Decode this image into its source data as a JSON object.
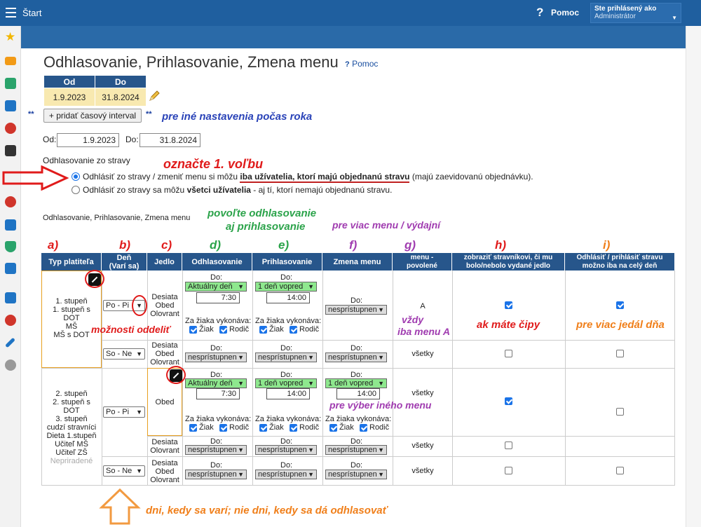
{
  "topbar": {
    "start": "Štart",
    "help": "Pomoc",
    "help_icon": "?",
    "user_label": "Ste prihlásený ako",
    "user_role": "Administrátor"
  },
  "sidebar": {
    "icons": [
      "star-icon",
      "mail-icon",
      "home-icon",
      "book-icon",
      "user-icon",
      "calendar-icon",
      "badge-icon",
      "briefcase-icon",
      "shield-icon",
      "chart-icon",
      "library-icon",
      "chat-icon",
      "pen-icon",
      "gear-icon"
    ]
  },
  "page": {
    "title": "Odhlasovanie, Prihlasovanie, Zmena menu",
    "help_link": "Pomoc",
    "help_prefix": "?"
  },
  "interval": {
    "col_od": "Od",
    "col_do": "Do",
    "od": "1.9.2023",
    "do": "31.8.2024",
    "add_button": "+ pridať časový interval",
    "stars": "**"
  },
  "filter": {
    "od_label": "Od:",
    "od_value": "1.9.2023",
    "do_label": "Do:",
    "do_value": "31.8.2024"
  },
  "unsubscribe": {
    "heading": "Odhlasovanie zo stravy",
    "option1_a": "Odhlásiť zo stravy / zmeniť menu si môžu",
    "option1_b": "iba užívatelia, ktorí majú objednanú stravu",
    "option1_c": "(majú zaevidovanú objednávku).",
    "option2_a": "Odhlásiť zo stravy sa môžu",
    "option2_b": "všetci užívatelia",
    "option2_c": "- aj tí, ktorí nemajú objednanú stravu."
  },
  "section_label": "Odhlasovanie, Prihlasovanie, Zmena menu",
  "annotations": {
    "other_settings": "pre iné nastavenia počas roka",
    "first_choice": "označte 1. voľbu",
    "allow": "povoľte odhlasovanie",
    "allow2": "aj prihlasovanie",
    "more_menus": "pre viac menu / výdajní",
    "split": "možnosti oddeliť",
    "chips": "ak máte čipy",
    "always_a": "vždy",
    "always_b": "iba menu A",
    "whole_day": "pre viac jedál dňa",
    "other_menu": "pre výber iného menu",
    "days": "dni, kedy sa varí;  nie dni, kedy sa dá odhlasovať",
    "letters": [
      "a)",
      "b)",
      "c)",
      "d)",
      "e)",
      "f)",
      "g)",
      "h)",
      "i)"
    ]
  },
  "grid": {
    "headers": {
      "typ": "Typ platiteľa",
      "den1": "Deň",
      "den2": "(Varí sa)",
      "jedlo": "Jedlo",
      "odhl": "Odhlasovanie",
      "prihl": "Prihlasovanie",
      "zmena": "Zmena menu",
      "menu1": "menu -",
      "menu2": "povolené",
      "zobr1": "zobraziť stravníkovi, či mu",
      "zobr2": "bolo/nebolo vydané jedlo",
      "cely1": "Odhlásiť / prihlásiť stravu",
      "cely2": "možno iba na celý deň"
    },
    "group1_types": [
      "1. stupeň",
      "1. stupeň  s",
      "DOT",
      "MŠ",
      "MŠ s DOT"
    ],
    "group2_types": [
      "2. stupeň",
      "2. stupeň  s",
      "DOT",
      "3. stupeň",
      "cudzí stravníci",
      "Dieta 1.stupeň",
      "Učiteľ MŠ",
      "Učiteľ ZŠ"
    ],
    "group2_unassigned": "Nepriradené",
    "day_popi": "Po - Pi",
    "day_sone": "So - Ne",
    "meal_three": [
      "Desiata",
      "Obed",
      "Olovrant"
    ],
    "meal_two": [
      "Desiata",
      "Olovrant"
    ],
    "meal_obed": "Obed",
    "do_label": "Do:",
    "current_day": "Aktuálny deň",
    "day_before": "1 deň vopred",
    "unavailable": "nesprístupnen",
    "time_odhl": "7:30",
    "time_prihl": "14:00",
    "performs": "Za žiaka vykonáva:",
    "ziak": "Žiak",
    "rodic": "Rodič",
    "menu_a": "A",
    "menu_all": "všetky"
  }
}
